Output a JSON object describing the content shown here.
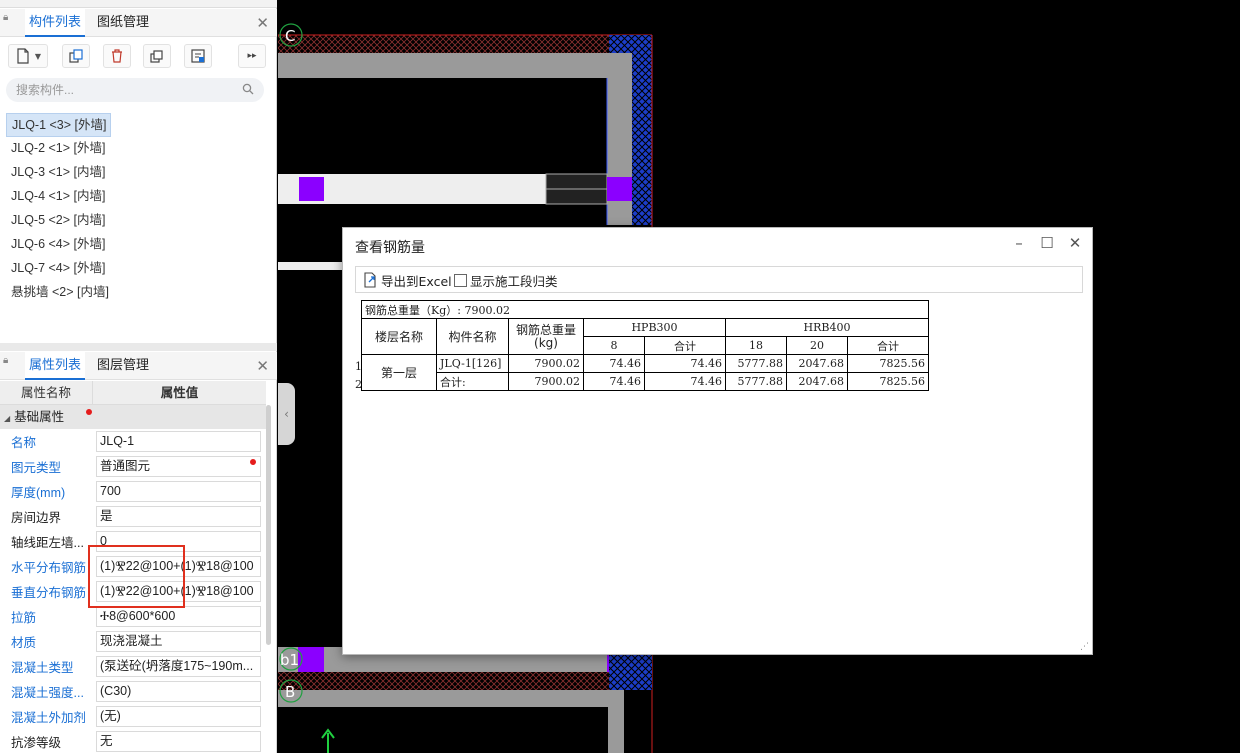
{
  "component_panel": {
    "tabs": [
      "构件列表",
      "图纸管理"
    ],
    "search_placeholder": "搜索构件...",
    "items": [
      "JLQ-1 <3> [外墙]",
      "JLQ-2 <1> [外墙]",
      "JLQ-3 <1> [内墙]",
      "JLQ-4 <1> [内墙]",
      "JLQ-5 <2> [内墙]",
      "JLQ-6 <4> [外墙]",
      "JLQ-7 <4> [外墙]",
      "悬挑墙 <2> [内墙]"
    ]
  },
  "property_panel": {
    "tabs": [
      "属性列表",
      "图层管理"
    ],
    "header": {
      "name": "属性名称",
      "value": "属性值"
    },
    "group": "基础属性",
    "rows": [
      {
        "name": "名称",
        "value": "JLQ-1"
      },
      {
        "name": "图元类型",
        "value": "普通图元"
      },
      {
        "name": "厚度(mm)",
        "value": "700"
      },
      {
        "name": "房间边界",
        "value": "是"
      },
      {
        "name": "轴线距左墙...",
        "value": "0"
      },
      {
        "name": "水平分布钢筋",
        "value": "(1)Ⰺ22@100+(1)Ⰺ18@100"
      },
      {
        "name": "垂直分布钢筋",
        "value": "(1)Ⰺ22@100+(1)Ⰺ18@100"
      },
      {
        "name": "拉筋",
        "value": "Ⰰ8@600*600"
      },
      {
        "name": "材质",
        "value": "现浇混凝土"
      },
      {
        "name": "混凝土类型",
        "value": "(泵送砼(坍落度175~190m..."
      },
      {
        "name": "混凝土强度...",
        "value": "(C30)"
      },
      {
        "name": "混凝土外加剂",
        "value": "(无)"
      },
      {
        "name": "抗渗等级",
        "value": "无"
      }
    ]
  },
  "canvas": {
    "axis_labels": [
      "C",
      "b1",
      "B"
    ]
  },
  "dialog": {
    "title": "查看钢筋量",
    "export_label": "导出到Excel",
    "checkbox_label": "显示施工段归类",
    "total_label": "钢筋总重量（Kg）: 7900.02",
    "headers": {
      "floor": "楼层名称",
      "component": "构件名称",
      "total_weight": "钢筋总重量(kg)",
      "hpb300": "HPB300",
      "hrb400": "HRB400",
      "d8": "8",
      "subtotal": "合计",
      "d18": "18",
      "d20": "20"
    },
    "rows": [
      {
        "num": "1",
        "floor": "第一层",
        "component": "JLQ-1[126]",
        "total": "7900.02",
        "h8": "74.46",
        "hsum": "74.46",
        "r18": "5777.88",
        "r20": "2047.68",
        "rsum": "7825.56"
      },
      {
        "num": "2",
        "component": "合计:",
        "total": "7900.02",
        "h8": "74.46",
        "hsum": "74.46",
        "r18": "5777.88",
        "r20": "2047.68",
        "rsum": "7825.56"
      }
    ]
  },
  "colors": {
    "accent": "#1a6fd4",
    "purple": "#8b00ff",
    "gray_wall": "#9a9a9a",
    "hatch_blue": "#1c3dc8",
    "highlight_red": "#e0301e"
  }
}
